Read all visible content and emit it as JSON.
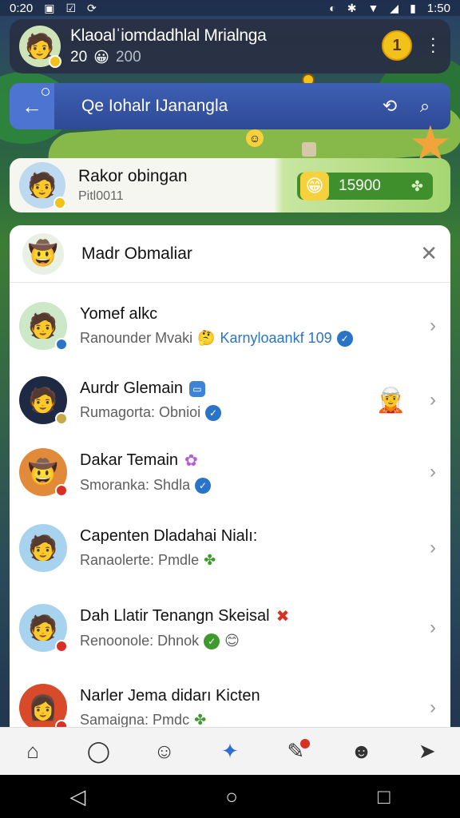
{
  "status_bar": {
    "time": "0:20",
    "clock": "1:50",
    "left_icons": [
      "screenshot-icon",
      "check-icon",
      "sync-icon"
    ],
    "right_icons": [
      "nfc-icon",
      "bluetooth-icon",
      "wifi-icon",
      "signal-icon",
      "battery-icon"
    ]
  },
  "profile": {
    "name": "Klaoalˈiomdadhlal Mrialnga",
    "level": "20",
    "points": "200",
    "coin_label": "1"
  },
  "search_bar": {
    "title": "Qe Iohalr IJanangla"
  },
  "highlight": {
    "name": "Rakor obingan",
    "subtitle": "Pitl0011",
    "score": "15900"
  },
  "list": {
    "title": "Madr Obmaliar",
    "items": [
      {
        "name": "Yomef alkc",
        "sub": "Ranounder Mvaki",
        "link": "Karnyloaankf 109"
      },
      {
        "name": "Aurdr Glemain",
        "sub": "Rumagorta: Obnioi",
        "link": ""
      },
      {
        "name": "Dakar Temain",
        "sub": "Smoranka: Shdla",
        "link": ""
      },
      {
        "name": "Capenten Dladahai Nialı:",
        "sub": "Ranaolerte: Pmdle",
        "link": ""
      },
      {
        "name": "Dah Llatir Tenangn Skeisal",
        "sub": "Renoonole: Dhnok",
        "link": ""
      },
      {
        "name": "Narler Jema didarı Kicten",
        "sub": "Samaigna: Pmdc",
        "link": ""
      }
    ]
  },
  "bottom_nav": [
    "home-icon",
    "chat-icon",
    "emoji-icon",
    "game-controller-icon",
    "notifications-icon",
    "robot-icon",
    "send-icon"
  ],
  "system_nav": [
    "back-icon",
    "home-icon",
    "recents-icon"
  ],
  "colors": {
    "accent": "#2c6fd0",
    "header": "#2f4a95",
    "success": "#3f8f2c",
    "coin": "#f2c21b"
  }
}
